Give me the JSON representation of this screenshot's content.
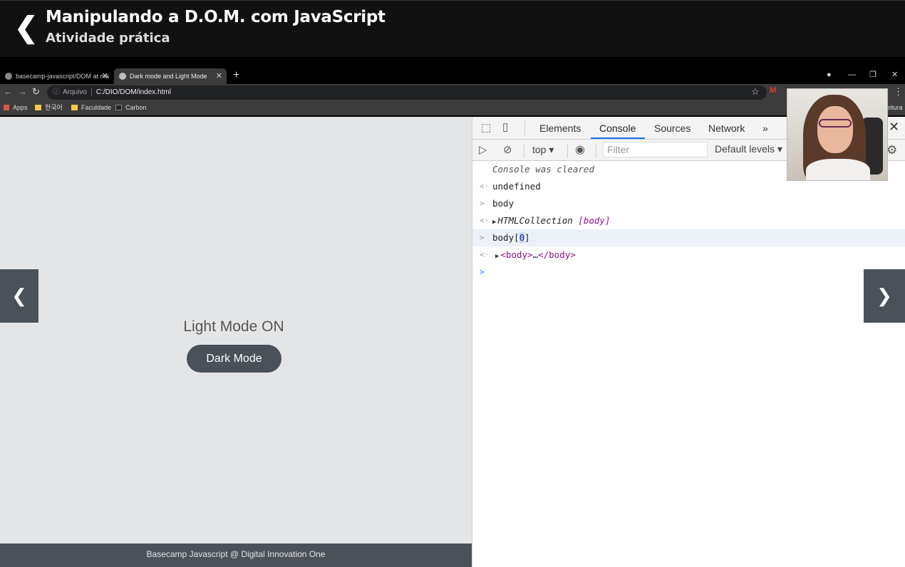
{
  "header": {
    "title": "Manipulando a D.O.M. com JavaScript",
    "subtitle": "Atividade prática"
  },
  "browser": {
    "tabs": [
      {
        "label": "basecamp-javascript/DOM at ma"
      },
      {
        "label": "Dark mode and Light Mode"
      }
    ],
    "address": {
      "prefix": "Arquivo",
      "url": "C:/DIO/DOM/index.html"
    },
    "bookmarks": [
      "Apps",
      "한국어",
      "Faculdade",
      "Carbon"
    ],
    "bookmark_overflow": "eitura"
  },
  "page": {
    "status_text": "Light Mode ON",
    "toggle_button": "Dark Mode",
    "footer": "Basecamp Javascript @ Digital Innovation One"
  },
  "devtools": {
    "tabs": [
      "Elements",
      "Console",
      "Sources",
      "Network"
    ],
    "active_tab": "Console",
    "context": "top",
    "filter_placeholder": "Filter",
    "levels": "Default levels",
    "console": {
      "cleared": "Console was cleared",
      "undefined": "undefined",
      "input1": "body",
      "output1_type": "HTMLCollection",
      "output1_value": "[body]",
      "input2_prefix": "body[",
      "input2_index": "0",
      "input2_suffix": "]",
      "output2_open": "<body>",
      "output2_ellipsis": "…",
      "output2_close": "</body>"
    }
  }
}
